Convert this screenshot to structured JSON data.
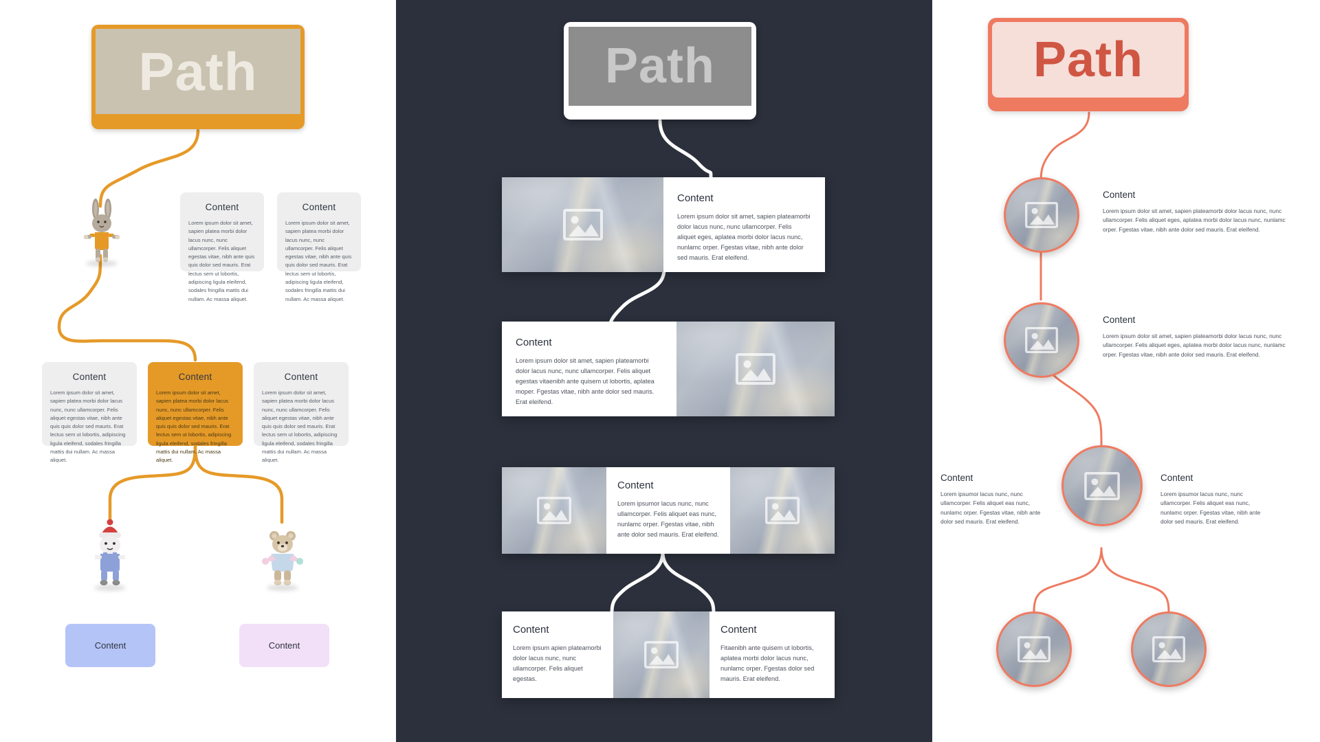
{
  "panels": {
    "left": {
      "header": {
        "title": "Path"
      },
      "accent_color": "#e59a28",
      "row1": [
        {
          "title": "Content",
          "body": "Lorem ipsum dolor sit amet, sapien platea morbi dolor lacus nunc, nunc ullamcorper. Felis aliquet egestas vitae, nibh ante quis quis dolor sed mauris. Erat lectus sem ut lobortis, adipiscing ligula eleifend, sodales fringilla mattis dui nullam. Ac massa aliquet."
        },
        {
          "title": "Content",
          "body": "Lorem ipsum dolor sit amet, sapien platea morbi dolor lacus nunc, nunc ullamcorper. Felis aliquet egestas vitae, nibh ante quis quis dolor sed mauris. Erat lectus sem ut lobortis, adipiscing ligula eleifend, sodales fringilla mattis dui nullam. Ac massa aliquet."
        }
      ],
      "row2": [
        {
          "title": "Content",
          "body": "Lorem ipsum dolor sit amet, sapien platea morbi dolor lacus nunc, nunc ullamcorper. Felis aliquet egestas vitae, nibh ante quis quis dolor sed mauris. Erat lectus sem ut lobortis, adipiscing ligula eleifend, sodales fringilla mattis dui nullam. Ac massa aliquet."
        },
        {
          "title": "Content",
          "body": "Lorem ipsum dolor sit amet, sapien platea morbi dolor lacus nunc, nunc ullamcorper. Felis aliquet egestas vitae, nibh ante quis quis dolor sed mauris. Erat lectus sem ut lobortis, adipiscing ligula eleifend, sodales fringilla mattis dui nullam. Ac massa aliquet."
        },
        {
          "title": "Content",
          "body": "Lorem ipsum dolor sit amet, sapien platea morbi dolor lacus nunc, nunc ullamcorper. Felis aliquet egestas vitae, nibh ante quis quis dolor sed mauris. Erat lectus sem ut lobortis, adipiscing ligula eleifend, sodales fringilla mattis dui nullam. Ac massa aliquet."
        }
      ],
      "boxes": [
        {
          "title": "Content",
          "color": "#b5c4f7"
        },
        {
          "title": "Content",
          "color": "#f2e0f8"
        }
      ],
      "figures": [
        {
          "name": "bunny-plush"
        },
        {
          "name": "snowman-plush"
        },
        {
          "name": "bear-plush"
        }
      ]
    },
    "middle": {
      "header": {
        "title": "Path"
      },
      "background_color": "#2b303c",
      "cards": [
        {
          "layout": "image-left",
          "title": "Content",
          "body": "Lorem ipsum dolor sit amet, sapien plateamorbi dolor lacus nunc, nunc ullamcorper. Felis aliquet eges, aplatea morbi dolor lacus nunc, nunlamc orper. Fgestas vitae, nibh ante dolor sed mauris. Erat eleifend."
        },
        {
          "layout": "text-left",
          "title": "Content",
          "body": "Lorem ipsum dolor sit amet, sapien plateamorbi dolor lacus nunc, nunc ullamcorper. Felis aliquet egestas vitaenibh ante quisem ut lobortis, aplatea moper. Fgestas vitae, nibh ante dolor sed mauris. Erat eleifend."
        },
        {
          "layout": "text-center",
          "title": "Content",
          "body": "Lorem ipsumor lacus nunc, nunc ullamcorper. Felis aliquet eas nunc, nunlamc orper. Fgestas vitae, nibh ante dolor sed mauris. Erat eleifend."
        },
        {
          "layout": "split-two",
          "title_left": "Content",
          "body_left": "Lorem ipsum apien plateamorbi dolor lacus nunc, nunc ullamcorper. Felis aliquet egestas.",
          "title_right": "Content",
          "body_right": "Fitaenibh ante quisem ut lobortis, aplatea morbi dolor lacus nunc, nunlamc orper. Fgestas dolor sed mauris. Erat eleifend."
        }
      ]
    },
    "right": {
      "header": {
        "title": "Path"
      },
      "accent_color": "#ee7a60",
      "nodes": [
        {
          "title": "Content",
          "body": "Lorem ipsum dolor sit amet, sapien plateamorbi dolor lacus nunc, nunc ullamcorper. Felis aliquet eges, aplatea morbi dolor lacus nunc, nunlamc orper. Fgestas vitae, nibh ante dolor sed mauris. Erat eleifend."
        },
        {
          "title": "Content",
          "body": "Lorem ipsum dolor sit amet, sapien plateamorbi dolor lacus nunc, nunc ullamcorper. Felis aliquet eges, aplatea morbi dolor lacus nunc, nunlamc orper. Fgestas vitae, nibh ante dolor sed mauris. Erat eleifend."
        }
      ],
      "split": {
        "left": {
          "title": "Content",
          "body": "Lorem ipsumor lacus nunc, nunc ullamcorper. Felis aliquet eas nunc, nunlamc orper. Fgestas vitae, nibh ante dolor sed mauris. Erat eleifend."
        },
        "right": {
          "title": "Content",
          "body": "Lorem ipsumor lacus nunc, nunc ullamcorper. Felis aliquet eas nunc, nunlamc orper. Fgestas vitae, nibh ante dolor sed mauris. Erat eleifend."
        }
      }
    }
  },
  "icons": {
    "image_placeholder": "image-placeholder-icon"
  }
}
